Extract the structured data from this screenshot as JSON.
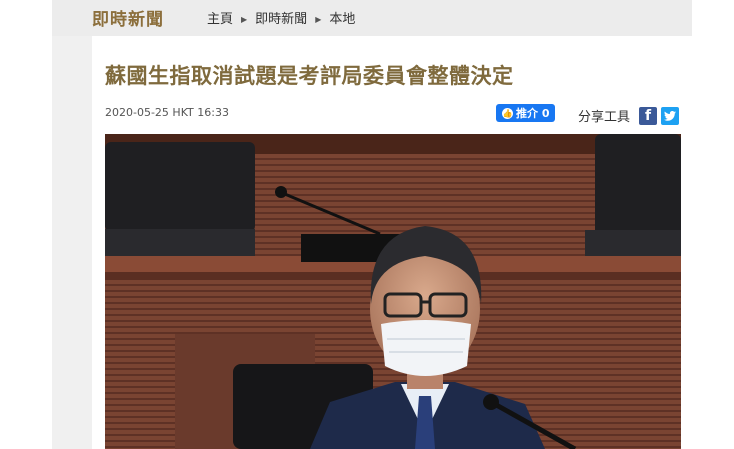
{
  "site": {
    "logo_text": "即時新聞"
  },
  "breadcrumb": {
    "items": [
      "主頁",
      "即時新聞",
      "本地"
    ]
  },
  "article": {
    "headline": "蘇國生指取消試題是考評局委員會整體決定",
    "timestamp": "2020-05-25 HKT 16:33",
    "like_button_label": "推介 0",
    "share_tools_label": "分享工具"
  },
  "colors": {
    "topbar_bg": "#ececec",
    "logo_color": "#8c6f3c",
    "headline_color": "#7f6a3d",
    "facebook_blue": "#1877f2",
    "twitter_blue": "#1da1f2"
  },
  "icons": {
    "breadcrumb_separator": "triangle-right-icon",
    "like": "thumbs-up-icon",
    "facebook_share": "facebook-icon",
    "twitter_share": "twitter-icon"
  }
}
